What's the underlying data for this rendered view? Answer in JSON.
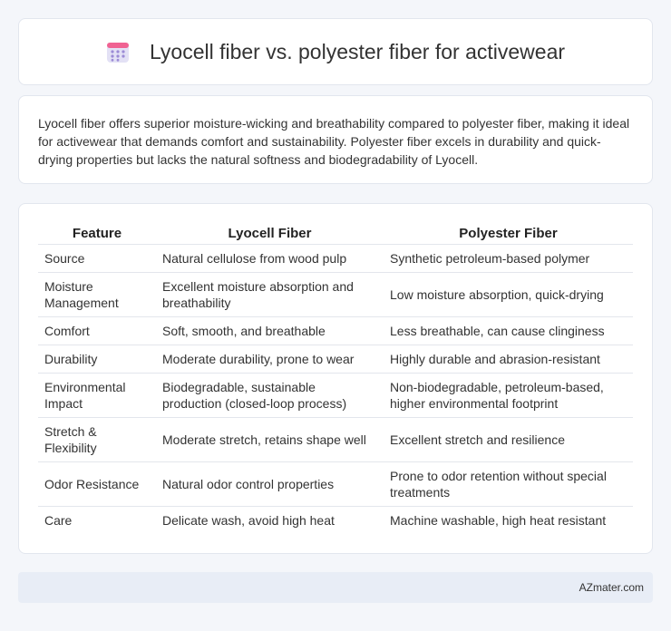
{
  "header": {
    "title": "Lyocell fiber vs. polyester fiber for activewear",
    "icon": "calendar-icon",
    "icon_colors": {
      "top": "#f06292",
      "body": "#e3e1f5",
      "dots": "#9c8bd6"
    }
  },
  "summary": {
    "text": "Lyocell fiber offers superior moisture-wicking and breathability compared to polyester fiber, making it ideal for activewear that demands comfort and sustainability. Polyester fiber excels in durability and quick-drying properties but lacks the natural softness and biodegradability of Lyocell."
  },
  "table": {
    "headers": [
      "Feature",
      "Lyocell Fiber",
      "Polyester Fiber"
    ],
    "rows": [
      [
        "Source",
        "Natural cellulose from wood pulp",
        "Synthetic petroleum-based polymer"
      ],
      [
        "Moisture Management",
        "Excellent moisture absorption and breathability",
        "Low moisture absorption, quick-drying"
      ],
      [
        "Comfort",
        "Soft, smooth, and breathable",
        "Less breathable, can cause clinginess"
      ],
      [
        "Durability",
        "Moderate durability, prone to wear",
        "Highly durable and abrasion-resistant"
      ],
      [
        "Environmental Impact",
        "Biodegradable, sustainable production (closed-loop process)",
        "Non-biodegradable, petroleum-based, higher environmental footprint"
      ],
      [
        "Stretch & Flexibility",
        "Moderate stretch, retains shape well",
        "Excellent stretch and resilience"
      ],
      [
        "Odor Resistance",
        "Natural odor control properties",
        "Prone to odor retention without special treatments"
      ],
      [
        "Care",
        "Delicate wash, avoid high heat",
        "Machine washable, high heat resistant"
      ]
    ]
  },
  "footer": {
    "brand": "AZmater.com"
  }
}
